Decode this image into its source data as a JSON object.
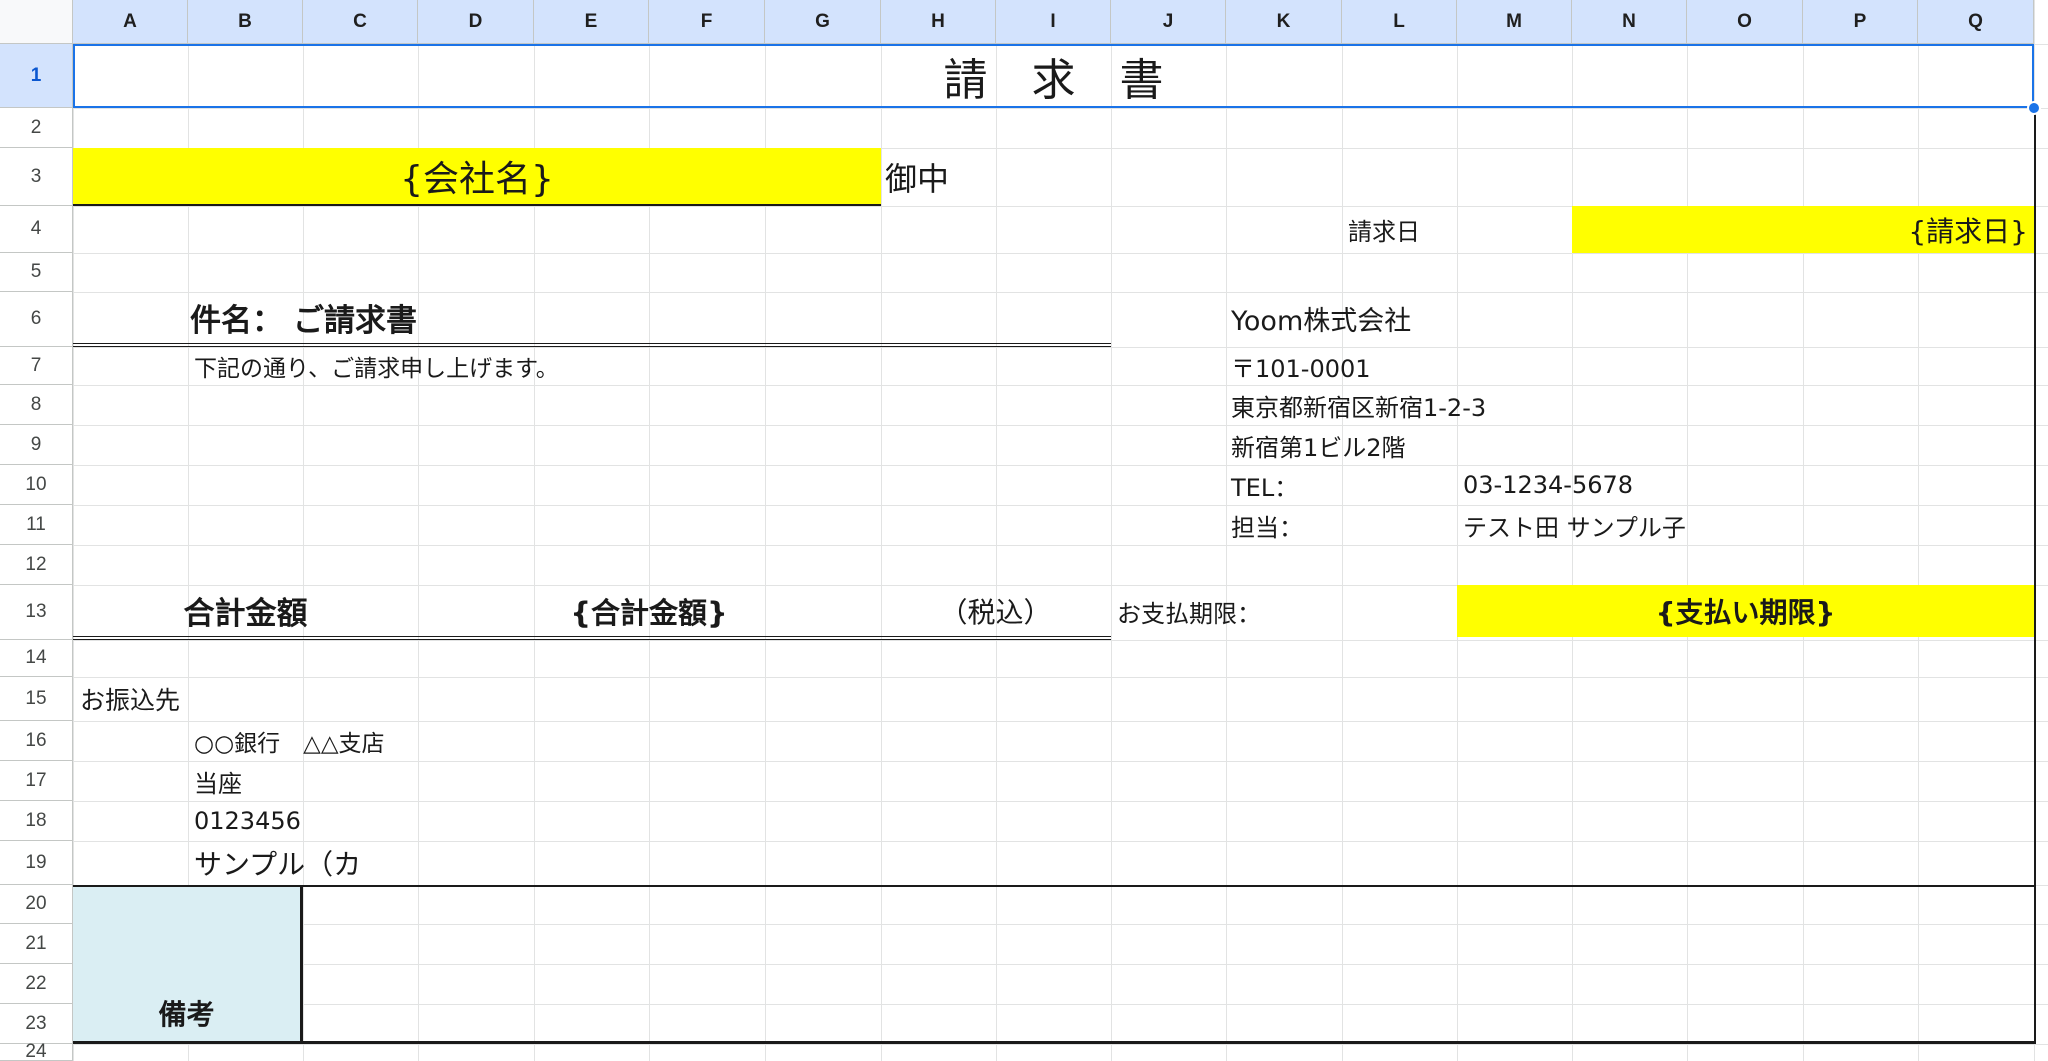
{
  "column_headers": [
    "A",
    "B",
    "C",
    "D",
    "E",
    "F",
    "G",
    "H",
    "I",
    "J",
    "K",
    "L",
    "M",
    "N",
    "O",
    "P",
    "Q"
  ],
  "row_headers": [
    "1",
    "2",
    "3",
    "4",
    "5",
    "6",
    "7",
    "8",
    "9",
    "10",
    "11",
    "12",
    "13",
    "14",
    "15",
    "16",
    "17",
    "18",
    "19",
    "20",
    "21",
    "22",
    "23",
    "24"
  ],
  "invoice": {
    "title": "請　求　書",
    "company_placeholder": "{会社名}",
    "honorific": "御中",
    "invoice_date_label": "請求日",
    "invoice_date_placeholder": "{請求日}",
    "subject_label": "件名：",
    "subject_value": "ご請求書",
    "intro_text": "下記の通り、ご請求申し上げます。",
    "total_label": "合計金額",
    "total_placeholder": "{合計金額}",
    "tax_note": "（税込）",
    "payment_due_label": "お支払期限：",
    "payment_due_placeholder": "{支払い期限}",
    "remarks_label": "備考"
  },
  "issuer": {
    "company": "Yoom株式会社",
    "postal": "〒101-0001",
    "address1": "東京都新宿区新宿1-2-3",
    "address2": "新宿第1ビル2階",
    "tel_label": "TEL：",
    "tel_value": "03-1234-5678",
    "contact_label": "担当：",
    "contact_value": "テスト田 サンプル子"
  },
  "bank": {
    "heading": "お振込先",
    "bank_branch": "○○銀行　△△支店",
    "account_type": "当座",
    "account_number": "0123456",
    "account_name": "サンプル（カ"
  },
  "colors": {
    "highlight": "#ffff00",
    "remarks_fill": "#daeef3",
    "selection": "#1a73e8",
    "header_fill": "#d3e3fd"
  }
}
